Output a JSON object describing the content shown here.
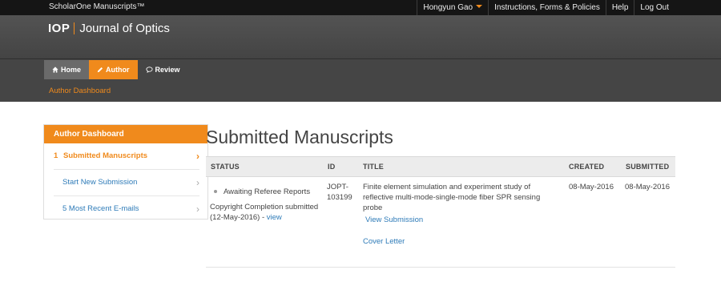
{
  "topbar": {
    "brand": "ScholarOne Manuscripts™",
    "user_name": "Hongyun Gao",
    "links": [
      "Instructions, Forms & Policies",
      "Help",
      "Log Out"
    ]
  },
  "header": {
    "logo_text": "IOP",
    "journal_title": "Journal of Optics"
  },
  "nav": {
    "tabs": [
      "Home",
      "Author",
      "Review"
    ],
    "active_tab": "Author",
    "breadcrumb": "Author Dashboard"
  },
  "sidebar": {
    "title": "Author Dashboard",
    "items": [
      {
        "number": "1",
        "label": "Submitted Manuscripts",
        "active": true
      },
      {
        "number": "",
        "label": "Start New Submission",
        "active": false
      },
      {
        "number": "",
        "label": "5 Most Recent E-mails",
        "active": false
      }
    ]
  },
  "main": {
    "title": "Submitted Manuscripts",
    "columns": [
      "STATUS",
      "ID",
      "TITLE",
      "CREATED",
      "SUBMITTED"
    ],
    "rows": [
      {
        "status": "Awaiting Referee Reports",
        "status_note": "Copyright Completion submitted (12-May-2016) -",
        "status_note_link": "view",
        "id": "JOPT-103199",
        "title": "Finite element simulation and experiment study of reflective multi-mode-single-mode fiber SPR sensing probe",
        "title_link": "View Submission",
        "cover_letter": "Cover Letter",
        "created": "08-May-2016",
        "submitted": "08-May-2016"
      }
    ]
  },
  "colors": {
    "accent": "#f08a1c",
    "link": "#2e7bb8",
    "topbar": "#151515",
    "header": "#4a4a4a"
  }
}
